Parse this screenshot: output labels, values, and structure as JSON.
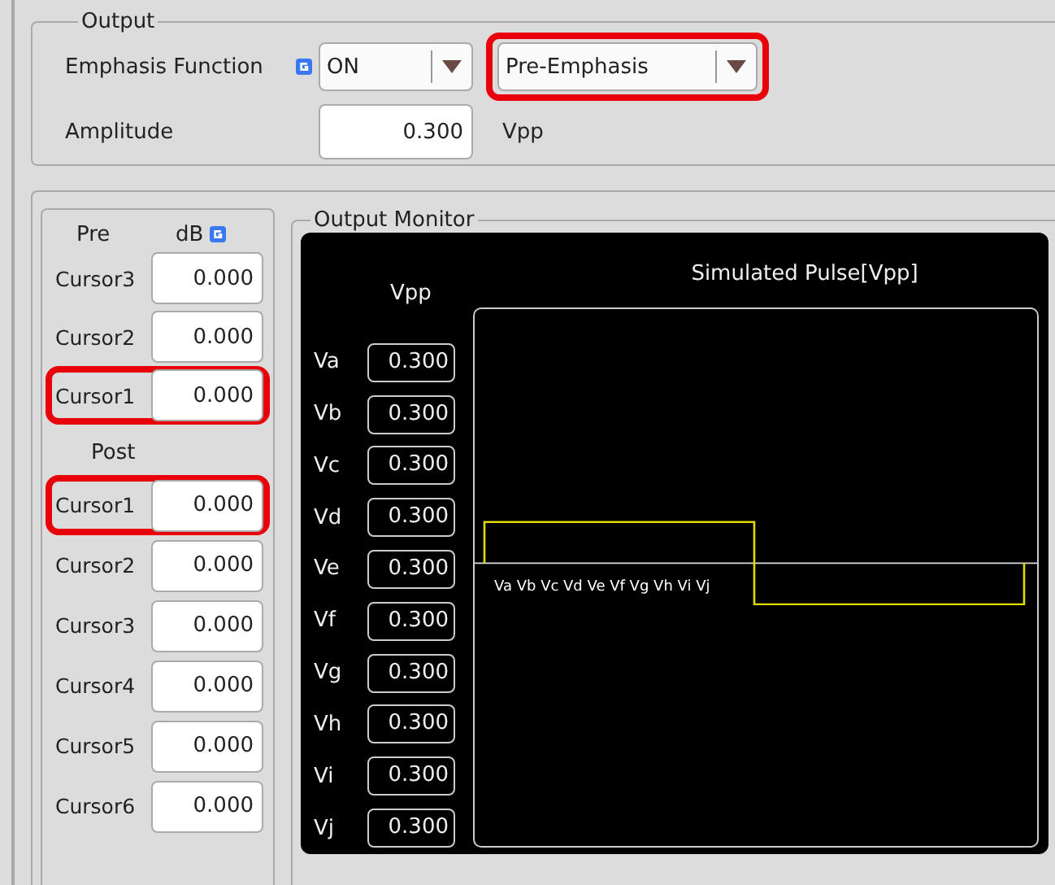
{
  "output": {
    "title": "Output",
    "emphasis": {
      "label": "Emphasis Function",
      "state": "ON",
      "mode": "Pre-Emphasis",
      "mode_highlighted": true
    },
    "amplitude": {
      "label": "Amplitude",
      "value": "0.300",
      "unit": "Vpp"
    }
  },
  "cursors": {
    "pre_label": "Pre",
    "unit_label": "dB",
    "pre": [
      {
        "label": "Cursor3",
        "value": "0.000",
        "highlighted": false
      },
      {
        "label": "Cursor2",
        "value": "0.000",
        "highlighted": false
      },
      {
        "label": "Cursor1",
        "value": "0.000",
        "highlighted": true
      }
    ],
    "post_label": "Post",
    "post": [
      {
        "label": "Cursor1",
        "value": "0.000",
        "highlighted": true
      },
      {
        "label": "Cursor2",
        "value": "0.000",
        "highlighted": false
      },
      {
        "label": "Cursor3",
        "value": "0.000",
        "highlighted": false
      },
      {
        "label": "Cursor4",
        "value": "0.000",
        "highlighted": false
      },
      {
        "label": "Cursor5",
        "value": "0.000",
        "highlighted": false
      },
      {
        "label": "Cursor6",
        "value": "0.000",
        "highlighted": false
      }
    ]
  },
  "monitor": {
    "title": "Output Monitor",
    "unit_label": "Vpp",
    "chart_title": "Simulated Pulse[Vpp]",
    "voltages": [
      {
        "label": "Va",
        "value": "0.300"
      },
      {
        "label": "Vb",
        "value": "0.300"
      },
      {
        "label": "Vc",
        "value": "0.300"
      },
      {
        "label": "Vd",
        "value": "0.300"
      },
      {
        "label": "Ve",
        "value": "0.300"
      },
      {
        "label": "Vf",
        "value": "0.300"
      },
      {
        "label": "Vg",
        "value": "0.300"
      },
      {
        "label": "Vh",
        "value": "0.300"
      },
      {
        "label": "Vi",
        "value": "0.300"
      },
      {
        "label": "Vj",
        "value": "0.300"
      }
    ],
    "pulse_labels": "Va Vb Vc Vd Ve Vf Vg Vh Vi Vj"
  }
}
